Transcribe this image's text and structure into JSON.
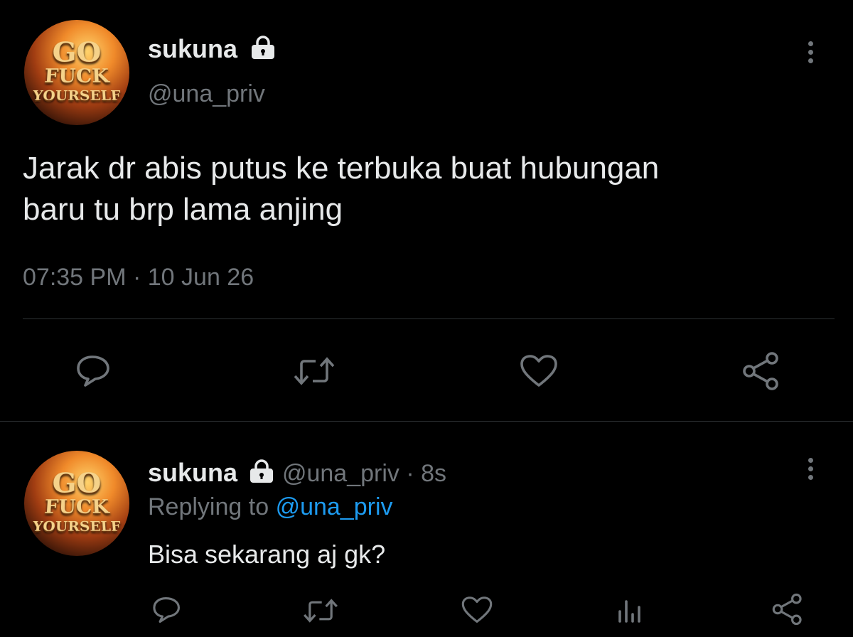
{
  "tweet": {
    "display_name": "sukuna",
    "handle": "@una_priv",
    "text_line1": "Jarak dr abis putus ke terbuka buat hubungan",
    "text_line2": "baru tu brp lama anjing",
    "time": "07:35 PM",
    "separator": "·",
    "date": "10 Jun 26",
    "avatar": {
      "line1": "GO",
      "line2": "FUCK",
      "line3": "YOURSELF"
    }
  },
  "reply": {
    "display_name": "sukuna",
    "handle": "@una_priv",
    "separator": "·",
    "age": "8s",
    "replying_prefix": "Replying to",
    "replying_handle": "@una_priv",
    "text": "Bisa sekarang aj gk?",
    "avatar": {
      "line1": "GO",
      "line2": "FUCK",
      "line3": "YOURSELF"
    }
  },
  "icons": {
    "more": "more-vertical-icon",
    "lock": "lock-icon",
    "reply": "comment-icon",
    "retweet": "retweet-icon",
    "like": "heart-icon",
    "share": "share-icon",
    "analytics": "analytics-icon"
  },
  "colors": {
    "background": "#000000",
    "text": "#e7e9ea",
    "muted": "#71767b",
    "link": "#1d9bf0",
    "divider": "#2f3336"
  }
}
